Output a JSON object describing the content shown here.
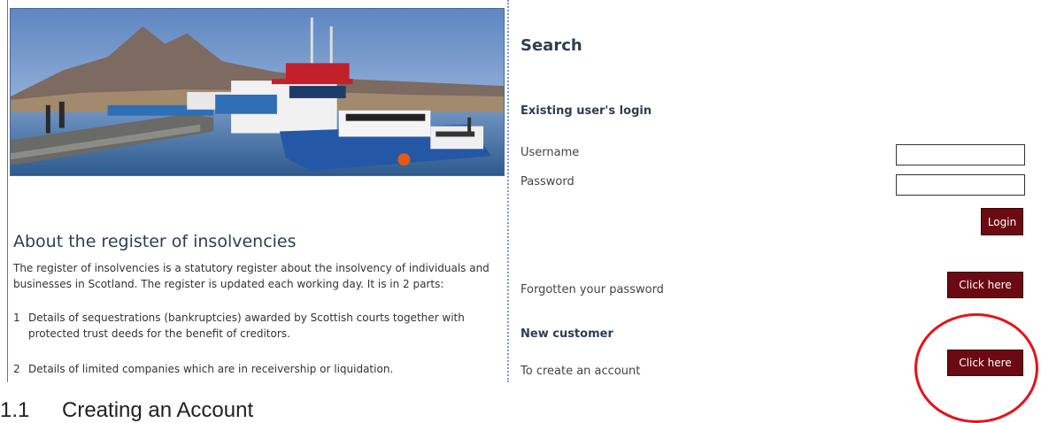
{
  "about": {
    "title": "About the register of insolvencies",
    "intro": "The register of insolvencies is a statutory register about the insolvency of individuals and businesses in Scotland. The register is updated each working day. It is in 2 parts:",
    "items": [
      {
        "num": "1",
        "text": "Details of sequestrations (bankruptcies) awarded by Scottish courts together with protected trust deeds for the benefit of creditors."
      },
      {
        "num": "2",
        "text": "Details of limited companies which are in receivership or liquidation."
      }
    ]
  },
  "search": {
    "title": "Search",
    "existing_heading": "Existing user's login",
    "username_label": "Username",
    "password_label": "Password",
    "username_value": "",
    "password_value": "",
    "login_label": "Login",
    "forgot_text": "Forgotten your password",
    "forgot_button": "Click here",
    "new_heading": "New customer",
    "create_text": "To create an account",
    "create_button": "Click here"
  },
  "caption": {
    "number": "1.1",
    "text": "Creating an Account"
  },
  "colors": {
    "button_bg": "#6b0a12",
    "heading": "#2d4050",
    "annotation": "#e8101a",
    "divider": "#7a9cc6"
  }
}
